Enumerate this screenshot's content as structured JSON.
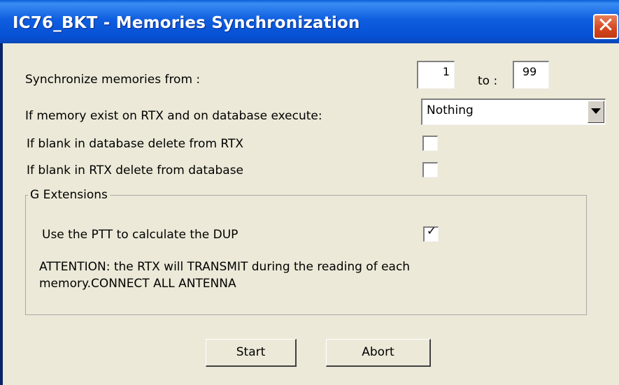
{
  "window": {
    "title": "IC76_BKT - Memories Synchronization",
    "close_glyph": "✕"
  },
  "sync": {
    "label": "Synchronize memories from  :",
    "from_value": "1",
    "to_label": "to :",
    "to_value": "99"
  },
  "conflict": {
    "label": "If memory exist on RTX and on database execute:",
    "selected": "Nothing"
  },
  "options": {
    "blank_db_label": "If blank in database delete from RTX",
    "blank_db_checked": false,
    "blank_rtx_label": "If blank in RTX delete from database",
    "blank_rtx_checked": false
  },
  "g_extensions": {
    "title": "G Extensions",
    "ptt_label": "Use the PTT to calculate the DUP",
    "ptt_checked": true,
    "ptt_mark": "✓",
    "attention_line1": "ATTENTION: the RTX will TRANSMIT during the reading of each",
    "attention_line2": "memory.CONNECT ALL ANTENNA"
  },
  "buttons": {
    "start": "Start",
    "abort": "Abort"
  }
}
